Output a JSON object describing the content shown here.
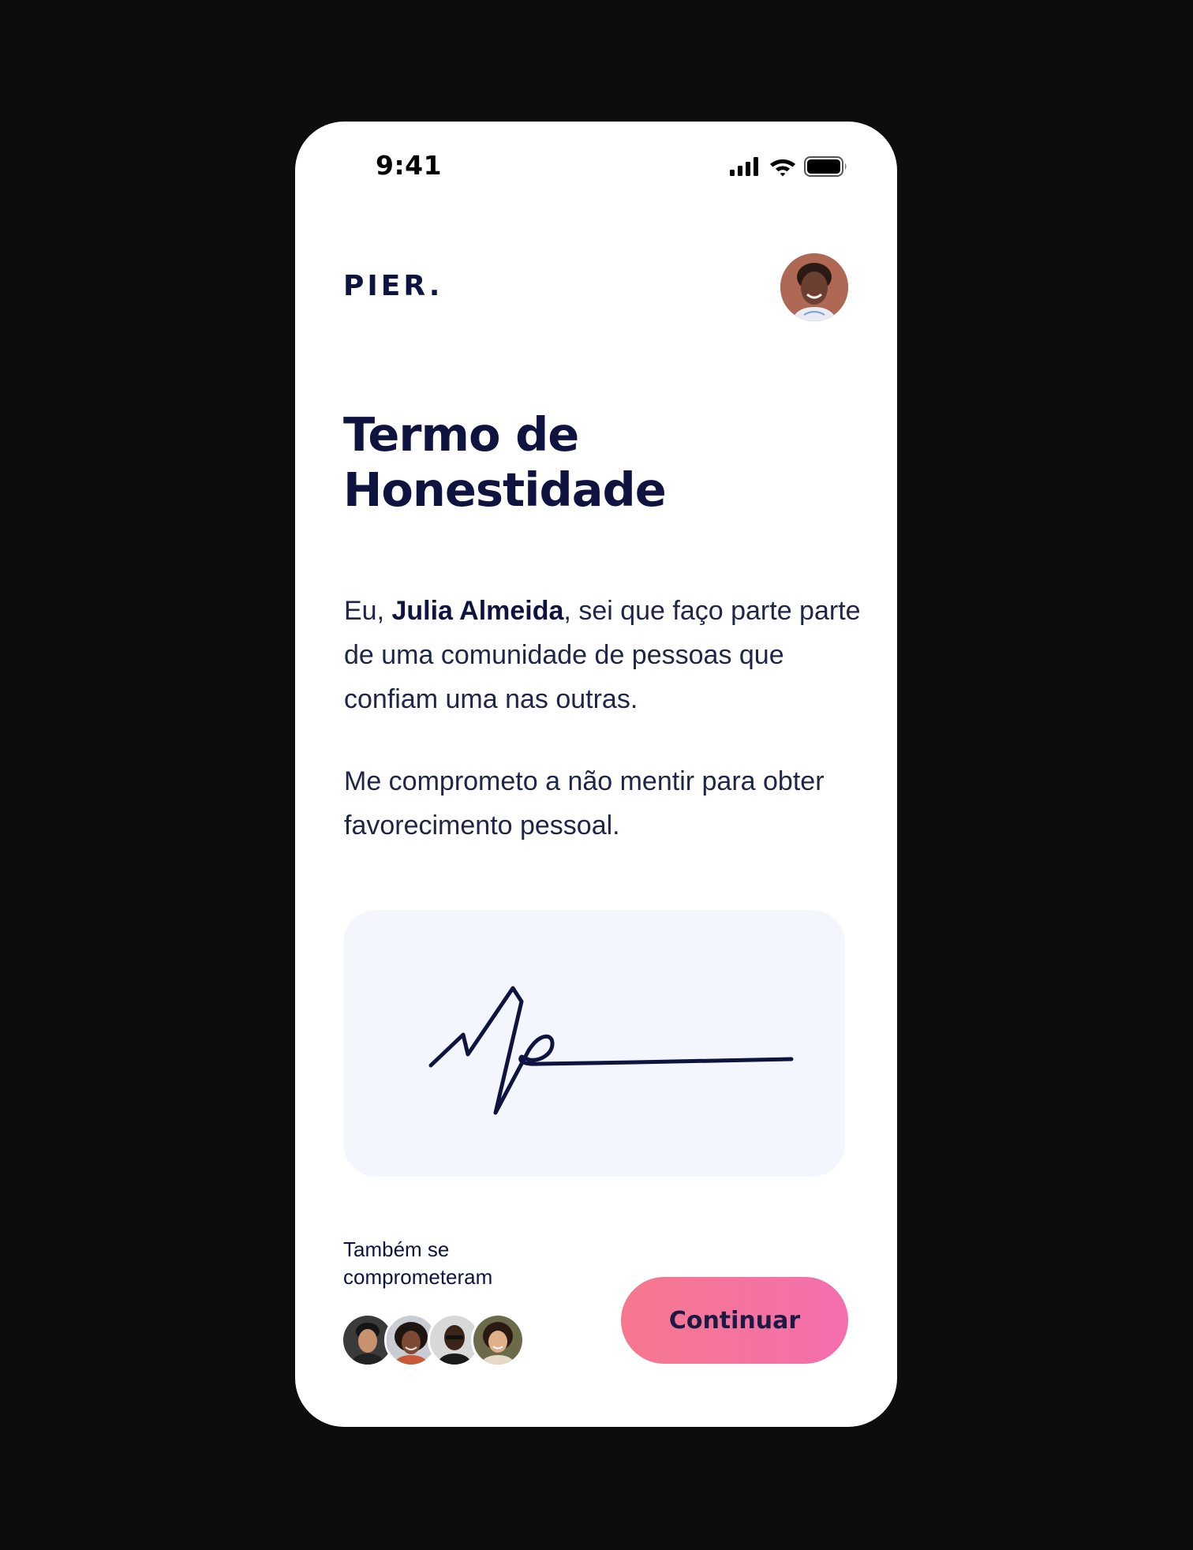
{
  "status_bar": {
    "time": "9:41",
    "icons": [
      "cellular-signal-icon",
      "wifi-icon",
      "battery-icon"
    ]
  },
  "header": {
    "brand": "PIER.",
    "avatar": "profile-avatar"
  },
  "content": {
    "title_line1": "Termo de",
    "title_line2": "Honestidade",
    "p1_prefix": "Eu, ",
    "p1_name": "Julia Almeida",
    "p1_rest": ", sei que faço parte parte de uma comunidade de pessoas que confiam uma nas outras.",
    "p2": "Me comprometo a não mentir para obter favorecimento pessoal."
  },
  "signature_pad": {
    "has_signature": true
  },
  "footer": {
    "also_committed_label": "Também se comprometeram",
    "committed_avatars": [
      "member-avatar-1",
      "member-avatar-2",
      "member-avatar-3",
      "member-avatar-4"
    ],
    "continue_label": "Continuar"
  },
  "colors": {
    "background": "#0d0d0d",
    "screen": "#ffffff",
    "text_primary": "#0e1340",
    "signature_pad": "#f3f7fd",
    "button_gradient_start": "#f5788d",
    "button_gradient_end": "#f46fae"
  }
}
